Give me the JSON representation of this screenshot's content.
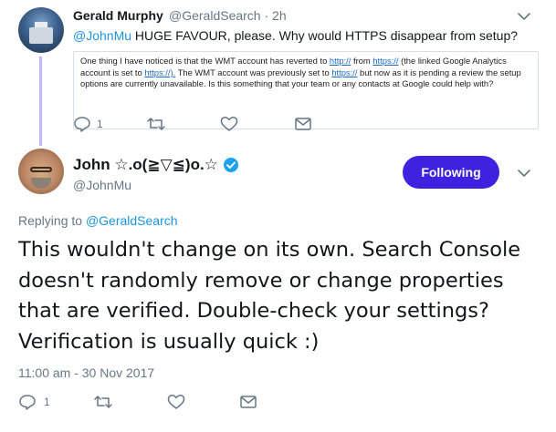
{
  "parent_tweet": {
    "author_name": "Gerald Murphy",
    "author_handle": "@GeraldSearch · 2h",
    "text_mention": "@JohnMu",
    "text_body": " HUGE FAVOUR, please. Why would HTTPS disappear from setup?",
    "quoted_image_text": {
      "part1": "One thing I have noticed is that the WMT account has reverted to ",
      "link1": "http://",
      "part2": " from ",
      "link2": "https://",
      "part3": " (the linked Google Analytics account is set to ",
      "link3": "https://).",
      "part4": " The WMT account was previously set to ",
      "link4": "https://",
      "part5": " but now as it is pending a review the setup options are currently unavailable. Is this something that your team or any contacts at Google could help with?"
    },
    "actions": {
      "reply_count": "1"
    }
  },
  "main_tweet": {
    "author_name": "John ☆.o(≧▽≦)o.☆",
    "author_handle": "@JohnMu",
    "follow_label": "Following",
    "replying_prefix": "Replying to ",
    "replying_to": "@GeraldSearch",
    "text": "This wouldn't change on its own. Search Console doesn't randomly remove or change properties that are verified. Double-check your settings? Verification is usually quick :)",
    "timestamp": "11:00 am - 30 Nov 2017",
    "actions": {
      "reply_count": "1"
    }
  },
  "colors": {
    "follow_button": "#3e22e0",
    "thread_line": "#c4b5ff",
    "link": "#1b95e0",
    "muted": "#657786"
  },
  "icons": [
    "reply-icon",
    "retweet-icon",
    "like-icon",
    "message-icon",
    "chevron-down-icon",
    "verified-badge-icon"
  ]
}
